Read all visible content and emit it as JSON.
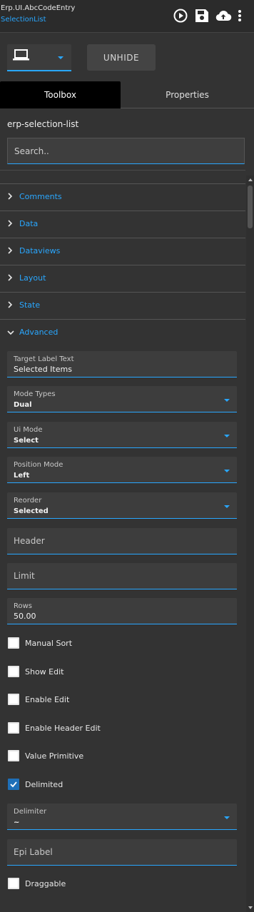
{
  "header": {
    "title": "Erp.UI.AbcCodeEntry",
    "subtitle": "SelectionList",
    "icons": [
      "play-icon",
      "save-icon",
      "cloud-upload-icon",
      "more-vertical-icon"
    ]
  },
  "toolbar": {
    "device_icon": "laptop-icon",
    "unhide_label": "UNHIDE"
  },
  "tabs": [
    {
      "label": "Toolbox",
      "active": true
    },
    {
      "label": "Properties",
      "active": false
    }
  ],
  "component_name": "erp-selection-list",
  "search": {
    "placeholder": "Search.."
  },
  "sections": [
    {
      "label": "Comments",
      "expanded": false
    },
    {
      "label": "Data",
      "expanded": false
    },
    {
      "label": "Dataviews",
      "expanded": false
    },
    {
      "label": "Layout",
      "expanded": false
    },
    {
      "label": "State",
      "expanded": false
    },
    {
      "label": "Advanced",
      "expanded": true
    }
  ],
  "advanced": {
    "target_label_text": {
      "label": "Target Label Text",
      "value": "Selected Items"
    },
    "mode_types": {
      "label": "Mode Types",
      "value": "Dual"
    },
    "ui_mode": {
      "label": "Ui Mode",
      "value": "Select"
    },
    "position_mode": {
      "label": "Position Mode",
      "value": "Left"
    },
    "reorder": {
      "label": "Reorder",
      "value": "Selected"
    },
    "header": {
      "placeholder": "Header"
    },
    "limit": {
      "placeholder": "Limit"
    },
    "rows": {
      "label": "Rows",
      "value": "50.00"
    },
    "checkboxes": [
      {
        "label": "Manual Sort",
        "checked": false
      },
      {
        "label": "Show Edit",
        "checked": false
      },
      {
        "label": "Enable Edit",
        "checked": false
      },
      {
        "label": "Enable Header Edit",
        "checked": false
      },
      {
        "label": "Value Primitive",
        "checked": false
      },
      {
        "label": "Delimited",
        "checked": true
      }
    ],
    "delimiter": {
      "label": "Delimiter",
      "value": "~"
    },
    "epi_label": {
      "placeholder": "Epi Label"
    },
    "draggable": {
      "label": "Draggable",
      "checked": false
    }
  },
  "colors": {
    "accent": "#29a7ff",
    "background": "#333333",
    "field_bg": "#3d3d3d",
    "checked": "#1e6fb8"
  }
}
